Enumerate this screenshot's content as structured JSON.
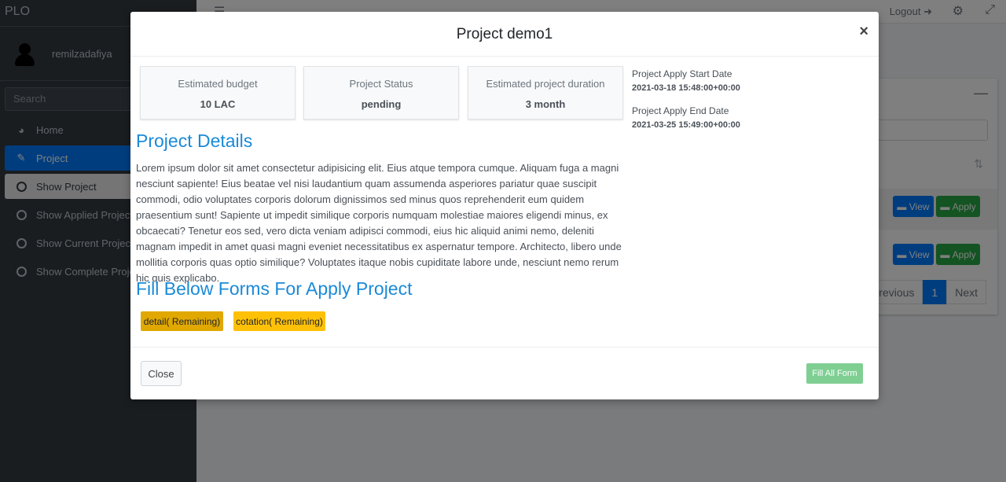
{
  "app": {
    "brand": "PLO"
  },
  "topbar": {
    "logout_label": "Logout",
    "menu_icon": "hamburger-icon",
    "settings_icon": "gear-icon",
    "expand_icon": "expand-icon"
  },
  "sidebar": {
    "user_name": "remilzadafiya",
    "search_placeholder": "Search",
    "items": [
      {
        "label": "Home",
        "icon": "dashboard-icon"
      },
      {
        "label": "Project",
        "icon": "edit-icon"
      },
      {
        "label": "Show Project",
        "icon": "circle-icon"
      },
      {
        "label": "Show Applied Project",
        "icon": "circle-icon"
      },
      {
        "label": "Show Current Project",
        "icon": "circle-icon"
      },
      {
        "label": "Show Complete Project",
        "icon": "circle-icon"
      }
    ]
  },
  "background_table": {
    "rows": [
      {
        "view_label": "View",
        "apply_label": "Apply"
      },
      {
        "view_label": "View",
        "apply_label": "Apply"
      }
    ],
    "pagination": {
      "previous": "Previous",
      "current": "1",
      "next": "Next"
    }
  },
  "modal": {
    "title": "Project demo1",
    "close_symbol": "×",
    "stats": [
      {
        "label": "Estimated budget",
        "value": "10 LAC"
      },
      {
        "label": "Project Status",
        "value": "pending"
      },
      {
        "label": "Estimated project duration",
        "value": "3 month"
      }
    ],
    "dates": {
      "start_label": "Project Apply Start Date",
      "start_value": "2021-03-18 15:48:00+00:00",
      "end_label": "Project Apply End Date",
      "end_value": "2021-03-25 15:49:00+00:00"
    },
    "details_heading": "Project Details",
    "description": "Lorem ipsum dolor sit amet consectetur adipisicing elit. Eius atque tempora cumque. Aliquam fuga a magni nesciunt sapiente! Eius beatae vel nisi laudantium quam assumenda asperiores pariatur quae suscipit commodi, odio voluptates corporis dolorum dignissimos sed minus quos reprehenderit eum quidem praesentium sunt! Sapiente ut impedit similique corporis numquam molestiae maiores eligendi minus, ex obcaecati? Tenetur eos sed, vero dicta veniam adipisci commodi, eius hic aliquid animi nemo, deleniti magnam impedit in amet quasi magni eveniet necessitatibus ex aspernatur tempore. Architecto, libero unde mollitia corporis quas optio similique? Voluptates itaque nobis cupiditate labore unde, nesciunt nemo rerum hic quis explicabo.",
    "forms_heading": "Fill Below Forms For Apply Project",
    "forms": [
      {
        "label": "detail( Remaining)",
        "color": "#e0a800"
      },
      {
        "label": "cotation( Remaining)",
        "color": "#ffc107"
      }
    ],
    "close_button": "Close",
    "fill_button": "Fill All Form"
  },
  "colors": {
    "primary": "#007bff",
    "success": "#28a745",
    "heading": "#1a8ad8",
    "warning": "#ffc107"
  }
}
